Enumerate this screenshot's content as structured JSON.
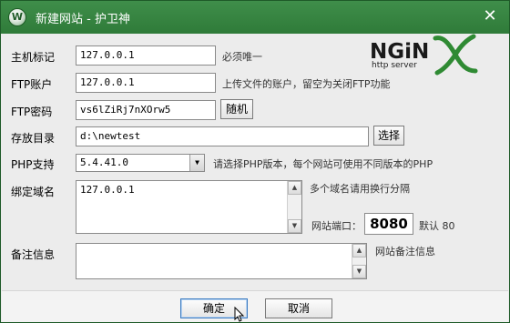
{
  "window": {
    "title": "新建网站 - 护卫神",
    "icon_letter": "W",
    "close_label": "✕"
  },
  "logo": {
    "main": "NGiN",
    "sub": "http server"
  },
  "form": {
    "host": {
      "label": "主机标记",
      "value": "127.0.0.1",
      "hint": "必须唯一"
    },
    "ftp_user": {
      "label": "FTP账户",
      "value": "127.0.0.1",
      "hint": "上传文件的账户，留空为关闭FTP功能"
    },
    "ftp_pass": {
      "label": "FTP密码",
      "value": "vs6lZiRj7nXOrw5",
      "random_label": "随机"
    },
    "dir": {
      "label": "存放目录",
      "value": "d:\\newtest",
      "browse_label": "选择"
    },
    "php": {
      "label": "PHP支持",
      "selected": "5.4.41.0",
      "hint": "请选择PHP版本，每个网站可使用不同版本的PHP"
    },
    "domain": {
      "label": "绑定域名",
      "value": "127.0.0.1",
      "hint": "多个域名请用换行分隔"
    },
    "port": {
      "label": "网站端口：",
      "value": "8080",
      "default_hint": "默认 80"
    },
    "note": {
      "label": "备注信息",
      "value": "",
      "hint": "网站备注信息"
    }
  },
  "buttons": {
    "ok": "确定",
    "cancel": "取消"
  },
  "colors": {
    "titlebar": "#2f7b39",
    "background": "#ececec"
  }
}
